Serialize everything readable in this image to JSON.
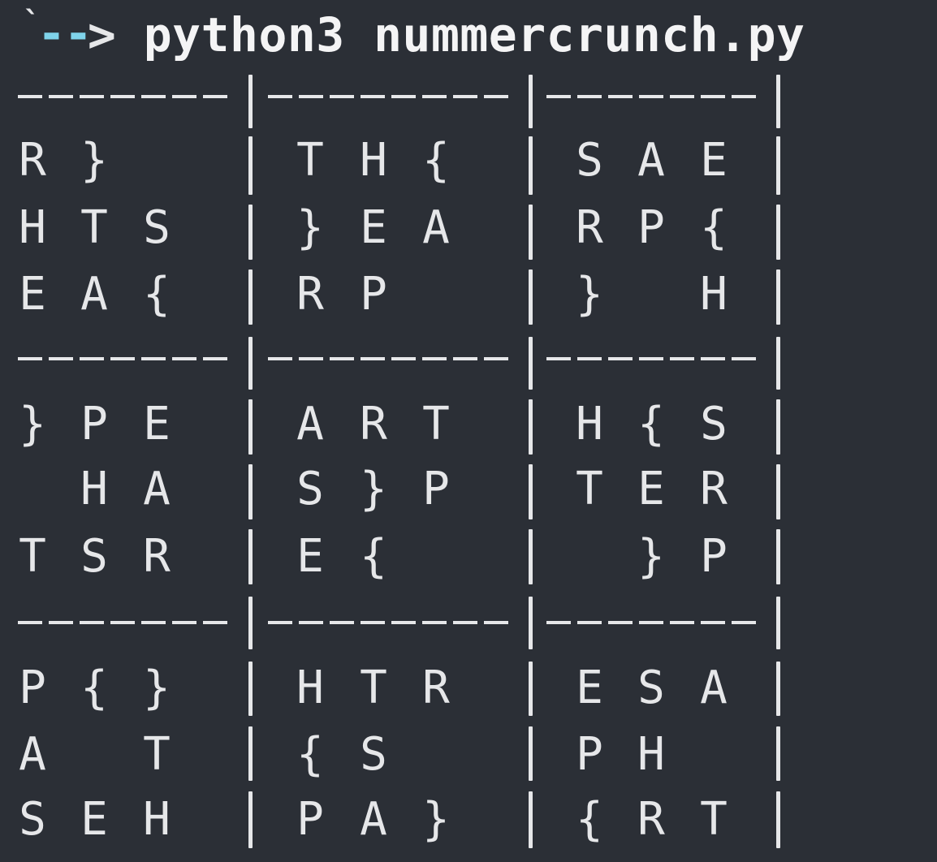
{
  "terminal": {
    "prompt_tick": "`",
    "prompt_arrow": "-->",
    "command": "python3 nummercrunch.py"
  },
  "sudoku_output": {
    "rows": [
      [
        [
          "R",
          "}",
          " "
        ],
        [
          "T",
          "H",
          "{"
        ],
        [
          "S",
          "A",
          "E"
        ]
      ],
      [
        [
          "H",
          "T",
          "S"
        ],
        [
          "}",
          "E",
          "A"
        ],
        [
          "R",
          "P",
          "{"
        ]
      ],
      [
        [
          "E",
          "A",
          "{"
        ],
        [
          "R",
          "P",
          " "
        ],
        [
          "}",
          " ",
          "H"
        ]
      ],
      [
        [
          "}",
          "P",
          "E"
        ],
        [
          "A",
          "R",
          "T"
        ],
        [
          "H",
          "{",
          "S"
        ]
      ],
      [
        [
          " ",
          "H",
          "A"
        ],
        [
          "S",
          "}",
          "P"
        ],
        [
          "T",
          "E",
          "R"
        ]
      ],
      [
        [
          "T",
          "S",
          "R"
        ],
        [
          "E",
          "{",
          " "
        ],
        [
          " ",
          "}",
          "P"
        ]
      ],
      [
        [
          "P",
          "{",
          "}"
        ],
        [
          "H",
          "T",
          "R"
        ],
        [
          "E",
          "S",
          "A"
        ]
      ],
      [
        [
          "A",
          " ",
          "T"
        ],
        [
          "{",
          "S",
          " "
        ],
        [
          "P",
          "H",
          " "
        ]
      ],
      [
        [
          "S",
          "E",
          "H"
        ],
        [
          "P",
          "A",
          "}"
        ],
        [
          "{",
          "R",
          "T"
        ]
      ]
    ]
  },
  "colors": {
    "background": "#2b2f36",
    "foreground": "#e6e7e9",
    "arrow_accent": "#7fd3ea"
  }
}
